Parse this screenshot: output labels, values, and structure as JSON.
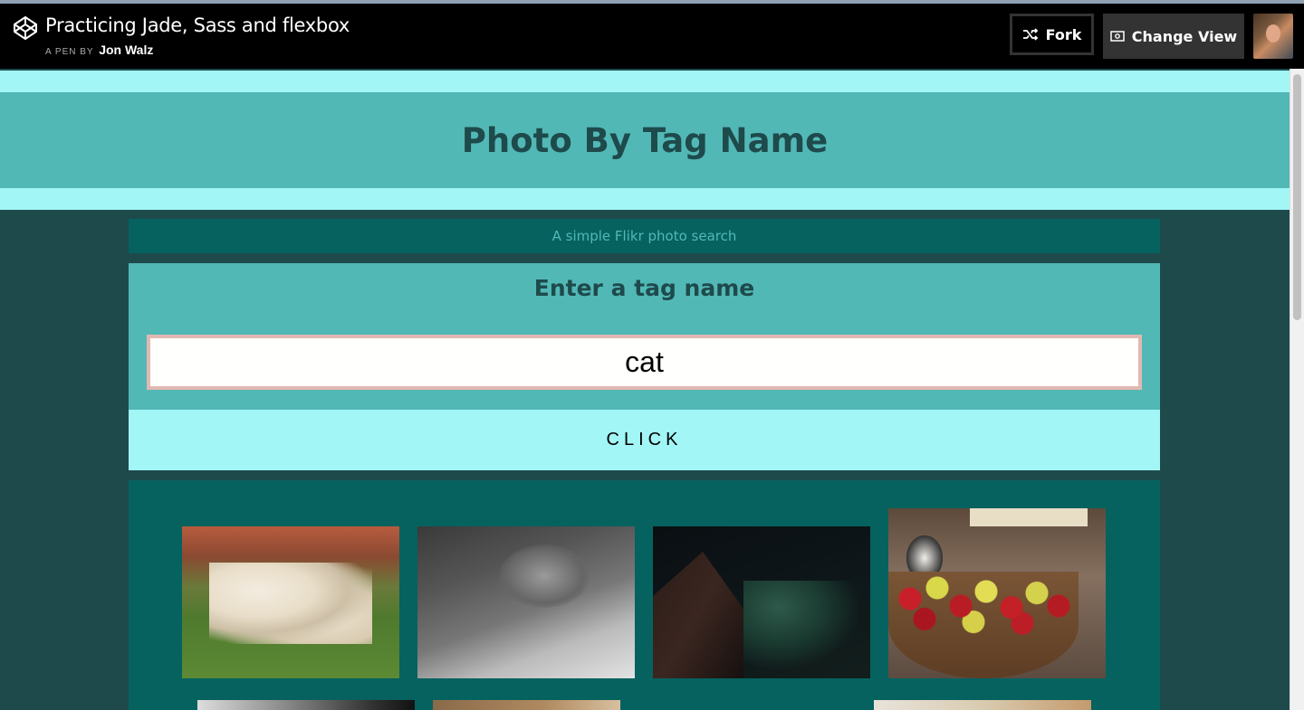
{
  "codepen": {
    "pen_title": "Practicing Jade, Sass and flexbox",
    "by_prefix": "A PEN BY",
    "author": "Jon Walz",
    "fork_label": "Fork",
    "change_view_label": "Change View"
  },
  "app": {
    "header_title": "Photo By Tag Name",
    "subtitle": "A simple Flikr photo search",
    "form_label": "Enter a tag name",
    "tag_value": "cat",
    "click_label": "CLICK"
  },
  "photos": [
    {
      "subject": "white tiger lying in grass"
    },
    {
      "subject": "black and white person sleeping with cat"
    },
    {
      "subject": "dark palm and rooftop at night"
    },
    {
      "subject": "basket of red and yellow apples with cat"
    }
  ],
  "colors": {
    "header_bg": "#52b8b6",
    "band": "#a2f6f5",
    "page_bg": "#1e4a4c",
    "panel_bg": "#05625f",
    "title_text": "#1e4a4c",
    "input_border": "#e1b9b2"
  },
  "icons": {
    "logo": "codepen-logo-icon",
    "fork": "fork-icon",
    "view": "eye-window-icon"
  }
}
